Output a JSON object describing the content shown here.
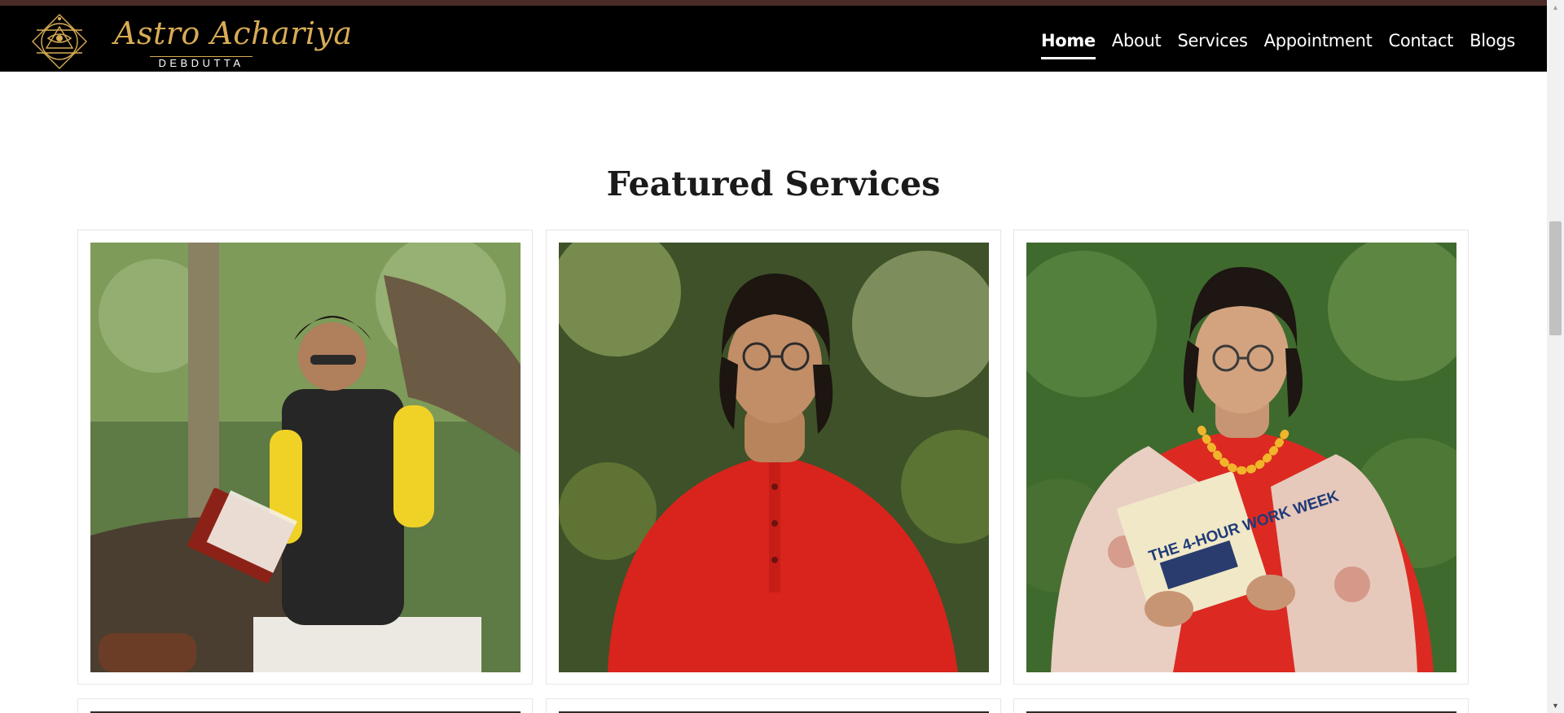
{
  "site": {
    "logo_script": "Astro Achariya",
    "logo_subtitle": "DEBDUTTA"
  },
  "nav": {
    "items": [
      {
        "label": "Home",
        "active": true
      },
      {
        "label": "About",
        "active": false
      },
      {
        "label": "Services",
        "active": false
      },
      {
        "label": "Appointment",
        "active": false
      },
      {
        "label": "Contact",
        "active": false
      },
      {
        "label": "Blogs",
        "active": false
      }
    ]
  },
  "main": {
    "section_title": "Featured Services",
    "cards": [
      {
        "image": "man-reading-red-book-yellow-kurta-black-jacket"
      },
      {
        "image": "man-portrait-red-kurta-glasses"
      },
      {
        "image": "man-reading-4-hour-work-week-red-kurta-shawl"
      }
    ],
    "book_title": "THE 4-HOUR WORK WEEK"
  },
  "colors": {
    "nav_bg": "#000000",
    "top_strip": "#4a2a26",
    "logo_gold": "#d8ac55",
    "title_text": "#1a1a1a",
    "card_border": "#e6e6e6"
  },
  "icons": {
    "logo": "third-eye-emblem-icon",
    "scroll_up": "scroll-up-arrow-icon",
    "scroll_down": "scroll-down-arrow-icon"
  }
}
